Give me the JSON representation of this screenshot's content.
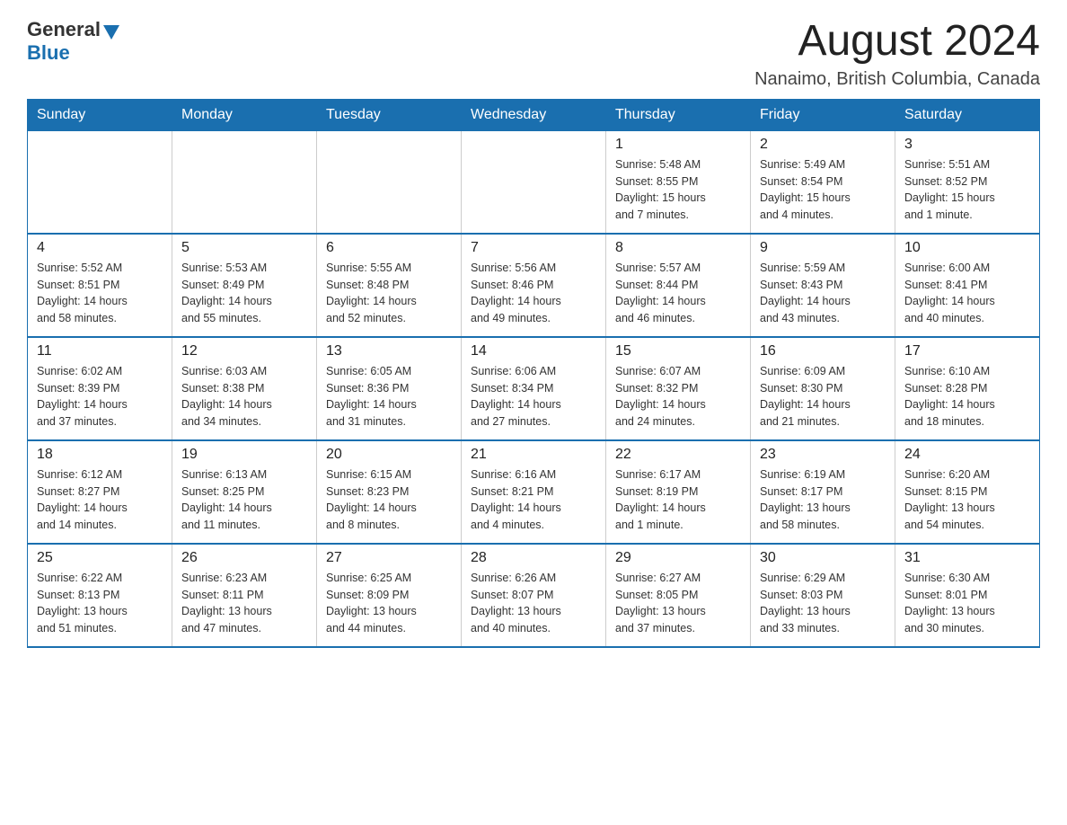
{
  "header": {
    "logo_general": "General",
    "logo_blue": "Blue",
    "month_title": "August 2024",
    "location": "Nanaimo, British Columbia, Canada"
  },
  "days_of_week": [
    "Sunday",
    "Monday",
    "Tuesday",
    "Wednesday",
    "Thursday",
    "Friday",
    "Saturday"
  ],
  "weeks": [
    [
      {
        "day": "",
        "info": ""
      },
      {
        "day": "",
        "info": ""
      },
      {
        "day": "",
        "info": ""
      },
      {
        "day": "",
        "info": ""
      },
      {
        "day": "1",
        "info": "Sunrise: 5:48 AM\nSunset: 8:55 PM\nDaylight: 15 hours\nand 7 minutes."
      },
      {
        "day": "2",
        "info": "Sunrise: 5:49 AM\nSunset: 8:54 PM\nDaylight: 15 hours\nand 4 minutes."
      },
      {
        "day": "3",
        "info": "Sunrise: 5:51 AM\nSunset: 8:52 PM\nDaylight: 15 hours\nand 1 minute."
      }
    ],
    [
      {
        "day": "4",
        "info": "Sunrise: 5:52 AM\nSunset: 8:51 PM\nDaylight: 14 hours\nand 58 minutes."
      },
      {
        "day": "5",
        "info": "Sunrise: 5:53 AM\nSunset: 8:49 PM\nDaylight: 14 hours\nand 55 minutes."
      },
      {
        "day": "6",
        "info": "Sunrise: 5:55 AM\nSunset: 8:48 PM\nDaylight: 14 hours\nand 52 minutes."
      },
      {
        "day": "7",
        "info": "Sunrise: 5:56 AM\nSunset: 8:46 PM\nDaylight: 14 hours\nand 49 minutes."
      },
      {
        "day": "8",
        "info": "Sunrise: 5:57 AM\nSunset: 8:44 PM\nDaylight: 14 hours\nand 46 minutes."
      },
      {
        "day": "9",
        "info": "Sunrise: 5:59 AM\nSunset: 8:43 PM\nDaylight: 14 hours\nand 43 minutes."
      },
      {
        "day": "10",
        "info": "Sunrise: 6:00 AM\nSunset: 8:41 PM\nDaylight: 14 hours\nand 40 minutes."
      }
    ],
    [
      {
        "day": "11",
        "info": "Sunrise: 6:02 AM\nSunset: 8:39 PM\nDaylight: 14 hours\nand 37 minutes."
      },
      {
        "day": "12",
        "info": "Sunrise: 6:03 AM\nSunset: 8:38 PM\nDaylight: 14 hours\nand 34 minutes."
      },
      {
        "day": "13",
        "info": "Sunrise: 6:05 AM\nSunset: 8:36 PM\nDaylight: 14 hours\nand 31 minutes."
      },
      {
        "day": "14",
        "info": "Sunrise: 6:06 AM\nSunset: 8:34 PM\nDaylight: 14 hours\nand 27 minutes."
      },
      {
        "day": "15",
        "info": "Sunrise: 6:07 AM\nSunset: 8:32 PM\nDaylight: 14 hours\nand 24 minutes."
      },
      {
        "day": "16",
        "info": "Sunrise: 6:09 AM\nSunset: 8:30 PM\nDaylight: 14 hours\nand 21 minutes."
      },
      {
        "day": "17",
        "info": "Sunrise: 6:10 AM\nSunset: 8:28 PM\nDaylight: 14 hours\nand 18 minutes."
      }
    ],
    [
      {
        "day": "18",
        "info": "Sunrise: 6:12 AM\nSunset: 8:27 PM\nDaylight: 14 hours\nand 14 minutes."
      },
      {
        "day": "19",
        "info": "Sunrise: 6:13 AM\nSunset: 8:25 PM\nDaylight: 14 hours\nand 11 minutes."
      },
      {
        "day": "20",
        "info": "Sunrise: 6:15 AM\nSunset: 8:23 PM\nDaylight: 14 hours\nand 8 minutes."
      },
      {
        "day": "21",
        "info": "Sunrise: 6:16 AM\nSunset: 8:21 PM\nDaylight: 14 hours\nand 4 minutes."
      },
      {
        "day": "22",
        "info": "Sunrise: 6:17 AM\nSunset: 8:19 PM\nDaylight: 14 hours\nand 1 minute."
      },
      {
        "day": "23",
        "info": "Sunrise: 6:19 AM\nSunset: 8:17 PM\nDaylight: 13 hours\nand 58 minutes."
      },
      {
        "day": "24",
        "info": "Sunrise: 6:20 AM\nSunset: 8:15 PM\nDaylight: 13 hours\nand 54 minutes."
      }
    ],
    [
      {
        "day": "25",
        "info": "Sunrise: 6:22 AM\nSunset: 8:13 PM\nDaylight: 13 hours\nand 51 minutes."
      },
      {
        "day": "26",
        "info": "Sunrise: 6:23 AM\nSunset: 8:11 PM\nDaylight: 13 hours\nand 47 minutes."
      },
      {
        "day": "27",
        "info": "Sunrise: 6:25 AM\nSunset: 8:09 PM\nDaylight: 13 hours\nand 44 minutes."
      },
      {
        "day": "28",
        "info": "Sunrise: 6:26 AM\nSunset: 8:07 PM\nDaylight: 13 hours\nand 40 minutes."
      },
      {
        "day": "29",
        "info": "Sunrise: 6:27 AM\nSunset: 8:05 PM\nDaylight: 13 hours\nand 37 minutes."
      },
      {
        "day": "30",
        "info": "Sunrise: 6:29 AM\nSunset: 8:03 PM\nDaylight: 13 hours\nand 33 minutes."
      },
      {
        "day": "31",
        "info": "Sunrise: 6:30 AM\nSunset: 8:01 PM\nDaylight: 13 hours\nand 30 minutes."
      }
    ]
  ]
}
